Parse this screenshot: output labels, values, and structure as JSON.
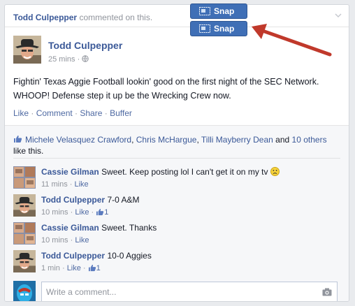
{
  "header": {
    "actor": "Todd Culpepper",
    "activity": "commented on this."
  },
  "post": {
    "author": "Todd Culpepper",
    "time": "25 mins",
    "privacy_icon": "globe-icon",
    "text": "Fightin' Texas Aggie Football lookin' good on the first night of the SEC Network. WHOOP! Defense step it up be the Wrecking Crew now.",
    "actions": [
      "Like",
      "Comment",
      "Share",
      "Buffer"
    ]
  },
  "likes": {
    "names": [
      "Michele Velasquez Crawford",
      "Chris McHargue",
      "Tilli Mayberry Dean"
    ],
    "and_text": "and",
    "others": "10 others",
    "suffix": "like this."
  },
  "comments": [
    {
      "name": "Cassie Gilman",
      "text": "Sweet. Keep posting lol I can't get it on my tv",
      "time": "11 mins",
      "like_label": "Like",
      "like_count": ""
    },
    {
      "name": "Todd Culpepper",
      "text": "7-0 A&M",
      "time": "10 mins",
      "like_label": "Like",
      "like_count": "1"
    },
    {
      "name": "Cassie Gilman",
      "text": "Sweet. Thanks",
      "time": "10 mins",
      "like_label": "Like",
      "like_count": ""
    },
    {
      "name": "Todd Culpepper",
      "text": "10-0 Aggies",
      "time": "1 min",
      "like_label": "Like",
      "like_count": "1"
    }
  ],
  "composer": {
    "placeholder": "Write a comment..."
  },
  "snap_buttons": [
    {
      "label": "Snap"
    },
    {
      "label": "Snap"
    }
  ],
  "colors": {
    "link": "#3b5998",
    "snap": "#3f6fb6",
    "arrow": "#c0392b"
  }
}
